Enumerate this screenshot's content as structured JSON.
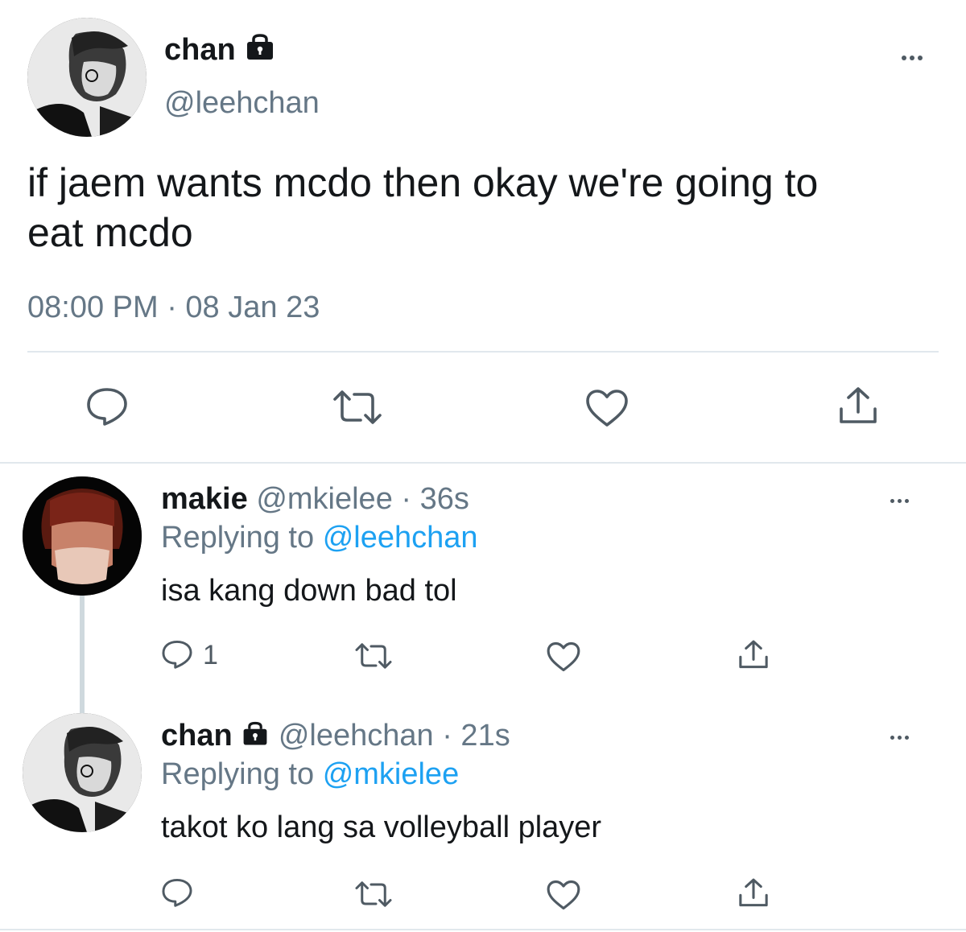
{
  "main_tweet": {
    "name": "chan",
    "handle": "@leehchan",
    "text_line1": "if jaem wants mcdo then okay we're going to",
    "text_line2": "eat mcdo",
    "timestamp": "08:00 PM · 08 Jan 23",
    "avatar_icon": "user-avatar-photo"
  },
  "replies": [
    {
      "name": "makie",
      "handle": "@mkielee",
      "time": "· 36s",
      "replying_label": "Replying to",
      "replying_to": "@leehchan",
      "text": "isa kang down bad tol",
      "reply_count": "1"
    },
    {
      "name": "chan",
      "handle": "@leehchan",
      "time": "· 21s",
      "replying_label": "Replying to",
      "replying_to": "@mkielee",
      "text": "takot ko lang sa volleyball player",
      "reply_count": ""
    }
  ],
  "colors": {
    "link": "#1da1f2",
    "muted": "#657786",
    "icon": "#4f5a63",
    "divider": "#e1e8ed"
  }
}
